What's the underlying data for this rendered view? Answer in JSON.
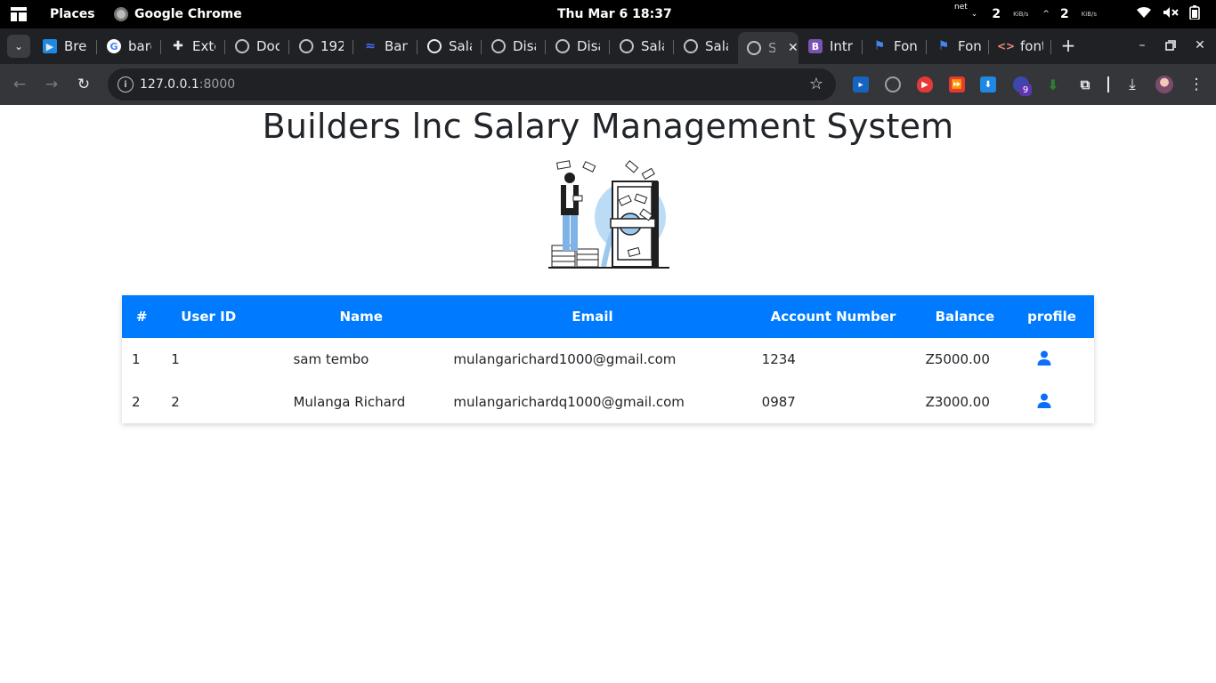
{
  "system_bar": {
    "places": "Places",
    "app_name": "Google Chrome",
    "clock": "Thu Mar 6  18:37",
    "net_label": "net",
    "down_value": "2",
    "down_unit": "KiB/s",
    "up_value": "2",
    "up_unit": "KiB/s"
  },
  "tabs": [
    {
      "label": "Bre",
      "icon": "play-store-icon"
    },
    {
      "label": "barc",
      "icon": "google-icon"
    },
    {
      "label": "Exte",
      "icon": "puzzle-icon"
    },
    {
      "label": "Doc",
      "icon": "globe-icon"
    },
    {
      "label": "192",
      "icon": "globe-icon"
    },
    {
      "label": "Ban",
      "icon": "logo-icon"
    },
    {
      "label": "Sala",
      "icon": "spiral-icon"
    },
    {
      "label": "Disa",
      "icon": "globe-icon"
    },
    {
      "label": "Disa",
      "icon": "globe-icon"
    },
    {
      "label": "Sala",
      "icon": "globe-icon"
    },
    {
      "label": "Sala",
      "icon": "globe-icon"
    },
    {
      "label": "S",
      "icon": "globe-icon",
      "active": true
    },
    {
      "label": "Intr",
      "icon": "bootstrap-icon"
    },
    {
      "label": "Fon",
      "icon": "flag-icon"
    },
    {
      "label": "Fon",
      "icon": "flag-icon"
    },
    {
      "label": "font",
      "icon": "code-icon"
    }
  ],
  "omnibox": {
    "host": "127.0.0.1",
    "port": ":8000"
  },
  "extensions": {
    "badge_count": "9"
  },
  "page": {
    "title": "Builders lnc Salary Management System",
    "table": {
      "headers": [
        "#",
        "User ID",
        "Name",
        "Email",
        "Account Number",
        "Balance",
        "profile"
      ],
      "rows": [
        {
          "index": "1",
          "user_id": "1",
          "name": "sam tembo",
          "email": "mulangarichard1000@gmail.com",
          "account": "1234",
          "balance": "Z5000.00"
        },
        {
          "index": "2",
          "user_id": "2",
          "name": "Mulanga Richard",
          "email": "mulangarichardq1000@gmail.com",
          "account": "0987",
          "balance": "Z3000.00"
        }
      ]
    }
  },
  "colors": {
    "header_blue": "#007bff",
    "profile_icon": "#0d6efd",
    "chrome_dark": "#202124",
    "chrome_toolbar": "#35363a"
  }
}
